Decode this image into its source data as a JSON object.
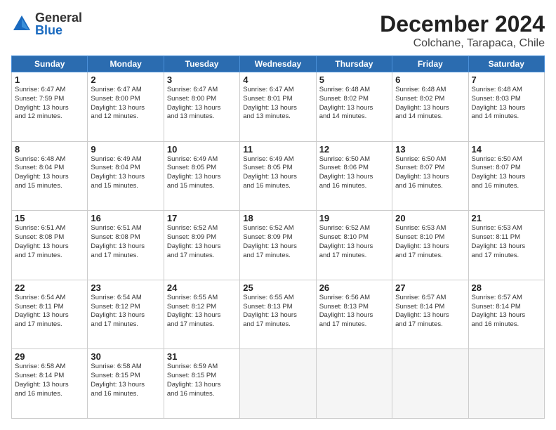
{
  "logo": {
    "general": "General",
    "blue": "Blue"
  },
  "title": "December 2024",
  "location": "Colchane, Tarapaca, Chile",
  "days_of_week": [
    "Sunday",
    "Monday",
    "Tuesday",
    "Wednesday",
    "Thursday",
    "Friday",
    "Saturday"
  ],
  "weeks": [
    [
      {
        "num": "1",
        "info": "Sunrise: 6:47 AM\nSunset: 7:59 PM\nDaylight: 13 hours\nand 12 minutes."
      },
      {
        "num": "2",
        "info": "Sunrise: 6:47 AM\nSunset: 8:00 PM\nDaylight: 13 hours\nand 12 minutes."
      },
      {
        "num": "3",
        "info": "Sunrise: 6:47 AM\nSunset: 8:00 PM\nDaylight: 13 hours\nand 13 minutes."
      },
      {
        "num": "4",
        "info": "Sunrise: 6:47 AM\nSunset: 8:01 PM\nDaylight: 13 hours\nand 13 minutes."
      },
      {
        "num": "5",
        "info": "Sunrise: 6:48 AM\nSunset: 8:02 PM\nDaylight: 13 hours\nand 14 minutes."
      },
      {
        "num": "6",
        "info": "Sunrise: 6:48 AM\nSunset: 8:02 PM\nDaylight: 13 hours\nand 14 minutes."
      },
      {
        "num": "7",
        "info": "Sunrise: 6:48 AM\nSunset: 8:03 PM\nDaylight: 13 hours\nand 14 minutes."
      }
    ],
    [
      {
        "num": "8",
        "info": "Sunrise: 6:48 AM\nSunset: 8:04 PM\nDaylight: 13 hours\nand 15 minutes."
      },
      {
        "num": "9",
        "info": "Sunrise: 6:49 AM\nSunset: 8:04 PM\nDaylight: 13 hours\nand 15 minutes."
      },
      {
        "num": "10",
        "info": "Sunrise: 6:49 AM\nSunset: 8:05 PM\nDaylight: 13 hours\nand 15 minutes."
      },
      {
        "num": "11",
        "info": "Sunrise: 6:49 AM\nSunset: 8:05 PM\nDaylight: 13 hours\nand 16 minutes."
      },
      {
        "num": "12",
        "info": "Sunrise: 6:50 AM\nSunset: 8:06 PM\nDaylight: 13 hours\nand 16 minutes."
      },
      {
        "num": "13",
        "info": "Sunrise: 6:50 AM\nSunset: 8:07 PM\nDaylight: 13 hours\nand 16 minutes."
      },
      {
        "num": "14",
        "info": "Sunrise: 6:50 AM\nSunset: 8:07 PM\nDaylight: 13 hours\nand 16 minutes."
      }
    ],
    [
      {
        "num": "15",
        "info": "Sunrise: 6:51 AM\nSunset: 8:08 PM\nDaylight: 13 hours\nand 17 minutes."
      },
      {
        "num": "16",
        "info": "Sunrise: 6:51 AM\nSunset: 8:08 PM\nDaylight: 13 hours\nand 17 minutes."
      },
      {
        "num": "17",
        "info": "Sunrise: 6:52 AM\nSunset: 8:09 PM\nDaylight: 13 hours\nand 17 minutes."
      },
      {
        "num": "18",
        "info": "Sunrise: 6:52 AM\nSunset: 8:09 PM\nDaylight: 13 hours\nand 17 minutes."
      },
      {
        "num": "19",
        "info": "Sunrise: 6:52 AM\nSunset: 8:10 PM\nDaylight: 13 hours\nand 17 minutes."
      },
      {
        "num": "20",
        "info": "Sunrise: 6:53 AM\nSunset: 8:10 PM\nDaylight: 13 hours\nand 17 minutes."
      },
      {
        "num": "21",
        "info": "Sunrise: 6:53 AM\nSunset: 8:11 PM\nDaylight: 13 hours\nand 17 minutes."
      }
    ],
    [
      {
        "num": "22",
        "info": "Sunrise: 6:54 AM\nSunset: 8:11 PM\nDaylight: 13 hours\nand 17 minutes."
      },
      {
        "num": "23",
        "info": "Sunrise: 6:54 AM\nSunset: 8:12 PM\nDaylight: 13 hours\nand 17 minutes."
      },
      {
        "num": "24",
        "info": "Sunrise: 6:55 AM\nSunset: 8:12 PM\nDaylight: 13 hours\nand 17 minutes."
      },
      {
        "num": "25",
        "info": "Sunrise: 6:55 AM\nSunset: 8:13 PM\nDaylight: 13 hours\nand 17 minutes."
      },
      {
        "num": "26",
        "info": "Sunrise: 6:56 AM\nSunset: 8:13 PM\nDaylight: 13 hours\nand 17 minutes."
      },
      {
        "num": "27",
        "info": "Sunrise: 6:57 AM\nSunset: 8:14 PM\nDaylight: 13 hours\nand 17 minutes."
      },
      {
        "num": "28",
        "info": "Sunrise: 6:57 AM\nSunset: 8:14 PM\nDaylight: 13 hours\nand 16 minutes."
      }
    ],
    [
      {
        "num": "29",
        "info": "Sunrise: 6:58 AM\nSunset: 8:14 PM\nDaylight: 13 hours\nand 16 minutes."
      },
      {
        "num": "30",
        "info": "Sunrise: 6:58 AM\nSunset: 8:15 PM\nDaylight: 13 hours\nand 16 minutes."
      },
      {
        "num": "31",
        "info": "Sunrise: 6:59 AM\nSunset: 8:15 PM\nDaylight: 13 hours\nand 16 minutes."
      },
      {
        "num": "",
        "info": ""
      },
      {
        "num": "",
        "info": ""
      },
      {
        "num": "",
        "info": ""
      },
      {
        "num": "",
        "info": ""
      }
    ]
  ]
}
